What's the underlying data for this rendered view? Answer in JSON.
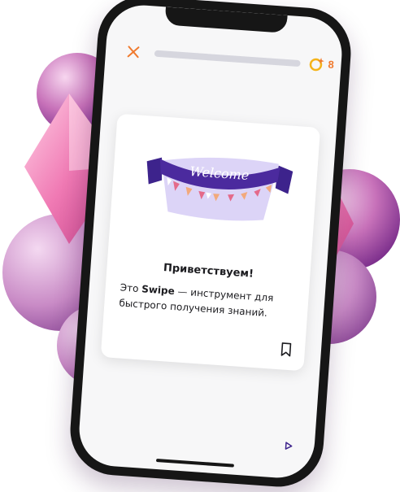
{
  "app": {
    "progress_fraction": 0.0,
    "coin_count": "8"
  },
  "card": {
    "illustration_text": "Welcome",
    "title": "Приветствуем!",
    "body_prefix": "Это ",
    "body_brand": "Swipe",
    "body_suffix": " — инструмент для быстрого получения знаний."
  },
  "colors": {
    "accent_orange": "#f07a2e",
    "banner_purple": "#3d238c",
    "banner_bg": "#dcd4f7",
    "flag_pink": "#e46a8a",
    "flag_peach": "#f2a97c"
  },
  "icons": [
    "close-icon",
    "coin-icon",
    "bookmark-icon",
    "play-next-icon"
  ]
}
